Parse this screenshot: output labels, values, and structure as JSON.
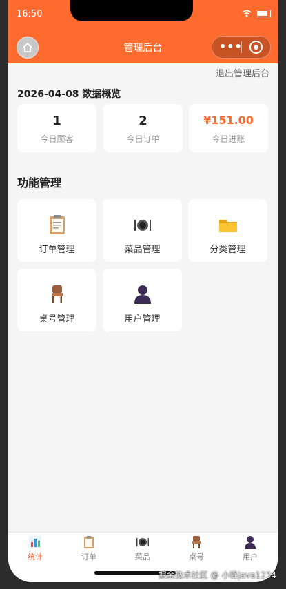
{
  "statusbar": {
    "time": "16:50"
  },
  "navbar": {
    "title": "管理后台"
  },
  "exit_link": "退出管理后台",
  "overview": {
    "title": "2026-04-08 数据概览",
    "stats": [
      {
        "value": "1",
        "label": "今日顾客"
      },
      {
        "value": "2",
        "label": "今日订单"
      },
      {
        "value": "¥151.00",
        "label": "今日进账"
      }
    ]
  },
  "functions": {
    "title": "功能管理",
    "items": [
      {
        "label": "订单管理",
        "icon": "clipboard-icon"
      },
      {
        "label": "菜品管理",
        "icon": "plate-cutlery-icon"
      },
      {
        "label": "分类管理",
        "icon": "folder-icon"
      },
      {
        "label": "桌号管理",
        "icon": "chair-icon"
      },
      {
        "label": "用户管理",
        "icon": "user-icon"
      }
    ]
  },
  "tabbar": {
    "items": [
      {
        "label": "统计",
        "icon": "chart-icon",
        "active": true
      },
      {
        "label": "订单",
        "icon": "clipboard-icon"
      },
      {
        "label": "菜品",
        "icon": "plate-cutlery-icon"
      },
      {
        "label": "桌号",
        "icon": "chair-icon"
      },
      {
        "label": "用户",
        "icon": "user-icon"
      }
    ]
  },
  "watermark": "掘金技术社区 @ 小锋java1234",
  "colors": {
    "accent": "#ff6a2e",
    "background": "#f5f5f5"
  }
}
